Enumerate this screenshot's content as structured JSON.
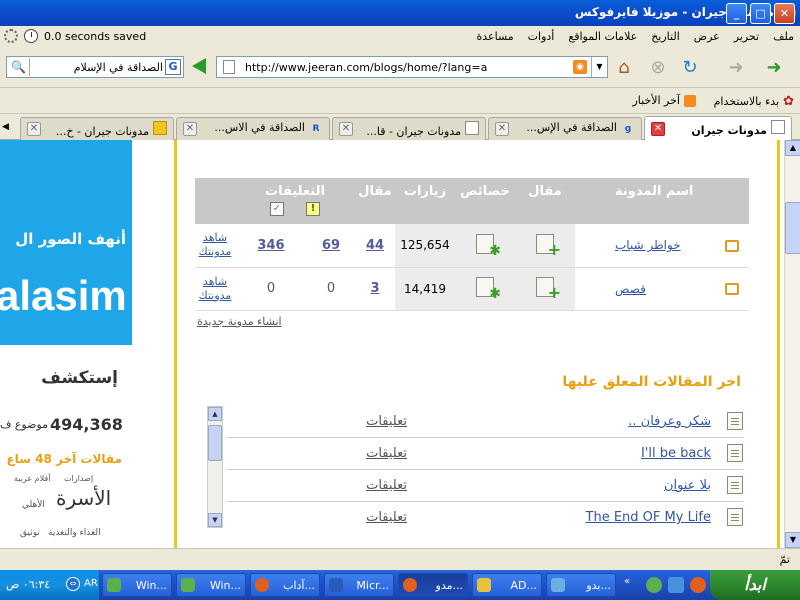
{
  "window": {
    "title": "مدونات جيران - موزيلا فايرفوكس",
    "controls": {
      "minimize": "_",
      "maximize": "□",
      "close": "✕"
    }
  },
  "menubar": {
    "items": [
      "ملف",
      "تحرير",
      "عرض",
      "التاريخ",
      "علامات المواقع",
      "أدوات",
      "مساعدة"
    ],
    "status_text": "0.0 seconds saved"
  },
  "navbar": {
    "search_value": "الصداقة في الإسلام",
    "search_engine": "G",
    "url": "http://www.jeeran.com/blogs/home/?lang=a"
  },
  "bookmarks": {
    "items": [
      "بدء بالاستخدام",
      "آخر الأخبار"
    ]
  },
  "tabs": [
    {
      "label": "مدونات جيران",
      "active": true
    },
    {
      "label": "الصداقة في الإس...",
      "active": false
    },
    {
      "label": "مدونات جيران - قا...",
      "active": false
    },
    {
      "label": "الصداقة في الاس...",
      "active": false
    },
    {
      "label": "مدونات جيران - خ...",
      "active": false
    }
  ],
  "sidebar": {
    "banner_text_ar": "أنهف الصور ال",
    "banner_brand": "alasim",
    "explore": "إستكشف",
    "topics_count": "494,368",
    "topics_label": "موضوع ف",
    "recent_label": "مقالات آخر 48 ساع",
    "tags": [
      "إصدارات",
      "الأسرة",
      "الأهلي",
      "الغذاء والتغذية",
      "أفلام عربية",
      "توثيق"
    ]
  },
  "blogs_table": {
    "headers": {
      "blog_name": "اسم المدونة",
      "article": "مقال",
      "properties": "خصائص",
      "visits": "زيارات",
      "articles": "مقال",
      "comments": "التعليقات"
    },
    "rows": [
      {
        "name": "خواطر شباب",
        "visits": "125,654",
        "articles": "44",
        "comments_a": "69",
        "comments_b": "346",
        "view": "شاهد مدونتك"
      },
      {
        "name": "قصص",
        "visits": "14,419",
        "articles": "3",
        "comments_a": "0",
        "comments_b": "0",
        "view": "شاهد مدونتك"
      }
    ],
    "new_blog": "انشاء مدونة جديدة"
  },
  "recent_articles": {
    "title": "اخر المقالات المعلق عليها",
    "rows": [
      {
        "title": "شكر وعرفان ..",
        "comments": "تعليقات"
      },
      {
        "title": "I'll be back",
        "comments": "تعليقات"
      },
      {
        "title": "بلا عنوان",
        "comments": "تعليقات"
      },
      {
        "title": "The End OF My Life",
        "comments": "تعليقات"
      }
    ]
  },
  "statusbar": {
    "text": "تمّ"
  },
  "taskbar": {
    "start": "ابدأ",
    "time": "٠٦:٣٤ ص",
    "lang": "AR",
    "tasks": [
      "مدو...",
      "Micr...",
      "آداب...",
      "Win...",
      "Win...",
      "AD...",
      "بدو..."
    ]
  }
}
